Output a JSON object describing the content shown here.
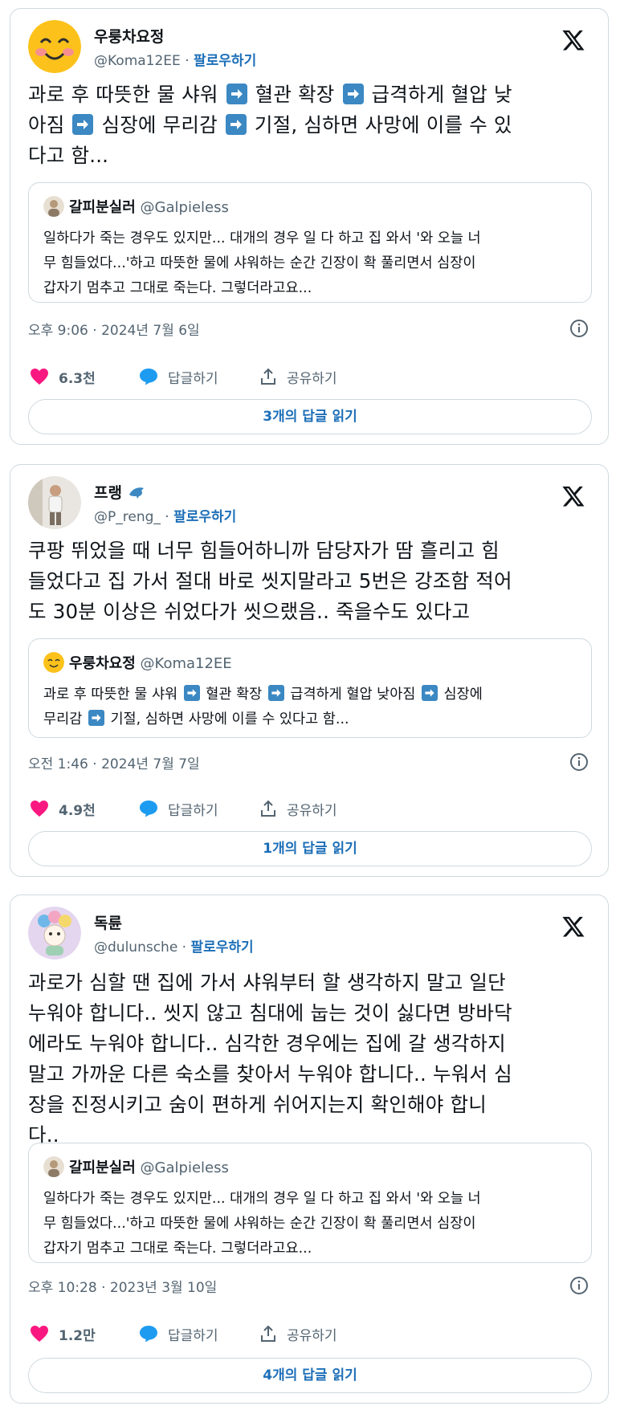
{
  "tweets": [
    {
      "name": "우룽차요정",
      "handle": "@Koma12EE",
      "follow": "팔로우하기",
      "lines": [
        [
          "과로 후 따뜻한 물 샤워 ",
          " 혈관 확장 ",
          " 급격하게 혈압 낮"
        ],
        [
          "아짐 ",
          " 심장에 무리감 ",
          " 기절, 심하면 사망에 이를 수 있"
        ],
        [
          "다고 함..."
        ]
      ],
      "quote": {
        "name": "갈피분실러",
        "handle": "@Galpieless",
        "lines": [
          "일하다가 죽는 경우도 있지만... 대개의 경우 일 다 하고 집 와서 '와 오늘 너",
          "무 힘들었다...'하고 따뜻한 물에 샤워하는 순간 긴장이 확 풀리면서 심장이",
          "갑자기 멈추고 그대로 죽는다. 그렇더라고요..."
        ]
      },
      "time": "오후 9:06 · 2024년 7월 6일",
      "likes": "6.3천",
      "reply": "답글하기",
      "share": "공유하기",
      "read_replies": "3개의 답글 읽기"
    },
    {
      "name": "프랭",
      "handle": "@P_reng_",
      "follow": "팔로우하기",
      "lines": [
        [
          "쿠팡 뛰었을 때 너무 힘들어하니까 담당자가 땀 흘리고 힘"
        ],
        [
          "들었다고 집 가서 절대 바로 씻지말라고 5번은 강조함 적어"
        ],
        [
          "도 30분 이상은 쉬었다가 씻으랬음.. 죽을수도 있다고"
        ]
      ],
      "quote": {
        "name": "우룽차요정",
        "handle": "@Koma12EE",
        "segs": [
          [
            "과로 후 따뜻한 물 샤워 ",
            " 혈관 확장 ",
            " 급격하게 혈압 낮아짐 ",
            " 심장에"
          ],
          [
            "무리감 ",
            " 기절, 심하면 사망에 이를 수 있다고 함..."
          ]
        ]
      },
      "time": "오전 1:46 · 2024년 7월 7일",
      "likes": "4.9천",
      "reply": "답글하기",
      "share": "공유하기",
      "read_replies": "1개의 답글 읽기"
    },
    {
      "name": "독륜",
      "handle": "@dulunsche",
      "follow": "팔로우하기",
      "lines": [
        [
          "과로가 심할 땐 집에 가서 샤워부터 할 생각하지 말고 일단"
        ],
        [
          "누워야 합니다.. 씻지 않고 침대에 눕는 것이 싫다면 방바닥"
        ],
        [
          "에라도 누워야 합니다.. 심각한 경우에는 집에 갈 생각하지"
        ],
        [
          "말고 가까운 다른 숙소를 찾아서 누워야 합니다.. 누워서 심"
        ],
        [
          "장을 진정시키고 숨이 편하게 쉬어지는지 확인해야 합니"
        ],
        [
          "다.."
        ]
      ],
      "quote": {
        "name": "갈피분실러",
        "handle": "@Galpieless",
        "lines": [
          "일하다가 죽는 경우도 있지만... 대개의 경우 일 다 하고 집 와서 '와 오늘 너",
          "무 힘들었다...'하고 따뜻한 물에 샤워하는 순간 긴장이 확 풀리면서 심장이",
          "갑자기 멈추고 그대로 죽는다. 그렇더라고요..."
        ]
      },
      "time": "오후 10:28 · 2023년 3월 10일",
      "likes": "1.2만",
      "reply": "답글하기",
      "share": "공유하기",
      "read_replies": "4개의 답글 읽기"
    }
  ],
  "separator": " · ",
  "colors": {
    "accent": "#1d6fb8",
    "like": "#f91880",
    "reply_icon": "#1d9bf0",
    "arrow_box": "#3b88c3"
  }
}
